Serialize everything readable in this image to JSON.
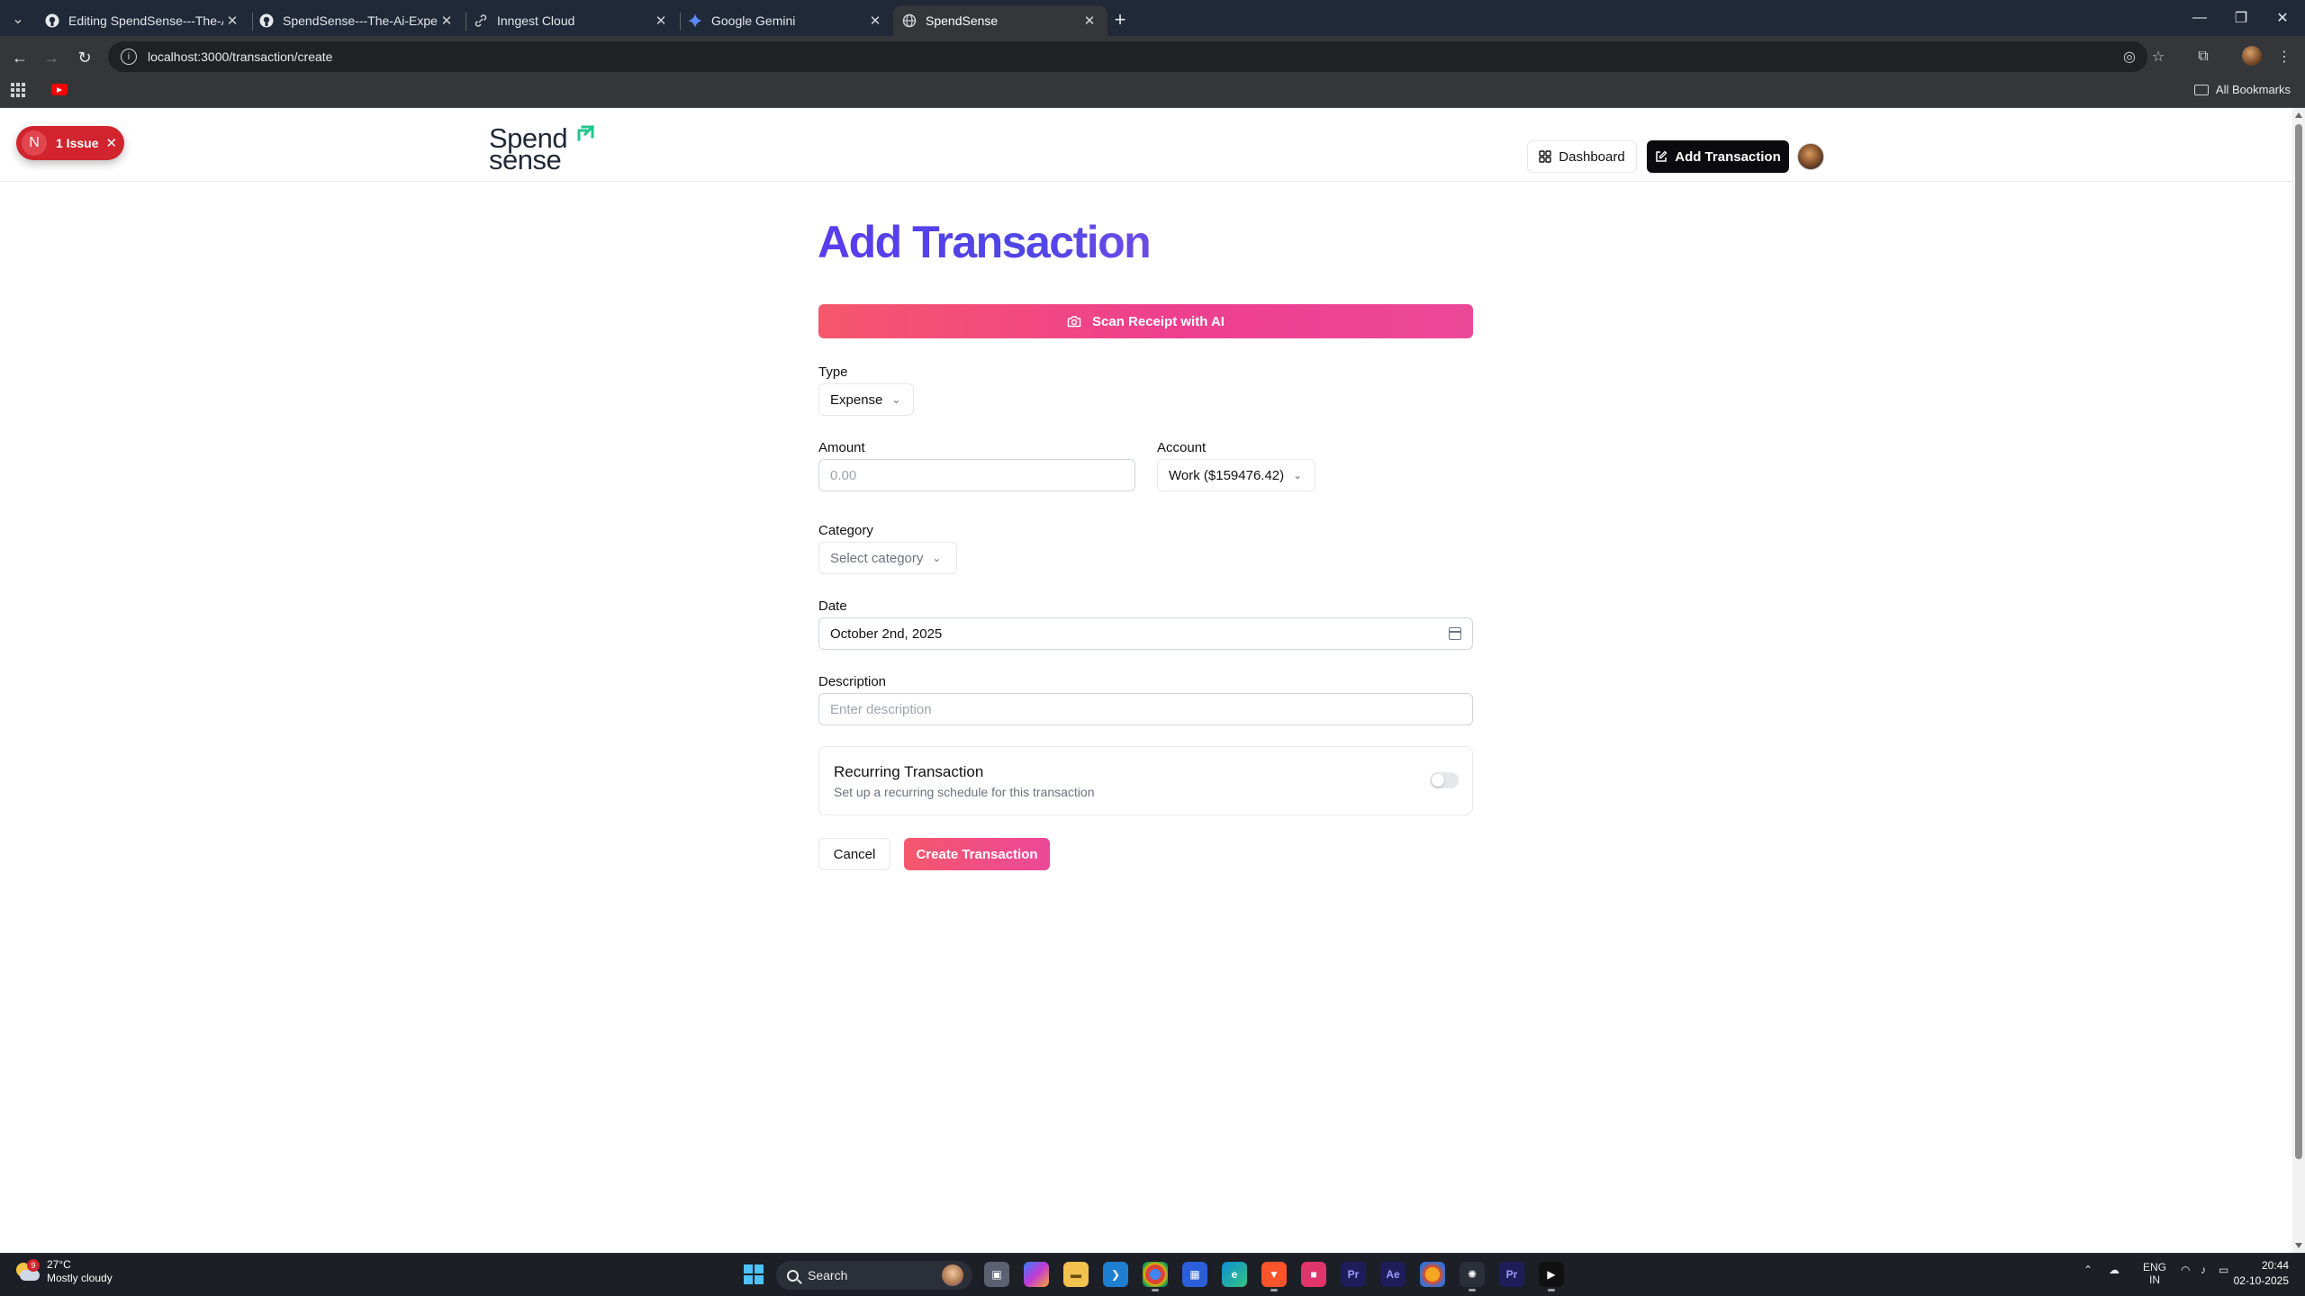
{
  "browser": {
    "tabs": [
      {
        "title": "Editing SpendSense---The-Ai-E",
        "icon": "github-icon",
        "active": false
      },
      {
        "title": "SpendSense---The-Ai-Expense",
        "icon": "github-icon",
        "active": false
      },
      {
        "title": "Inngest Cloud",
        "icon": "link-icon",
        "active": false
      },
      {
        "title": "Google Gemini",
        "icon": "gemini-icon",
        "active": false
      },
      {
        "title": "SpendSense",
        "icon": "globe-icon",
        "active": true
      }
    ],
    "url": "localhost:3000/transaction/create",
    "bookmarks_all_label": "All Bookmarks"
  },
  "devtools": {
    "badge_logo": "N",
    "issue_label": "1 Issue"
  },
  "site": {
    "logo_line1": "Spend",
    "logo_line2": "sense",
    "nav": {
      "dashboard_label": "Dashboard",
      "add_transaction_label": "Add Transaction"
    }
  },
  "form": {
    "title": "Add Transaction",
    "scan_button_label": "Scan Receipt with AI",
    "type": {
      "label": "Type",
      "value": "Expense"
    },
    "amount": {
      "label": "Amount",
      "placeholder": "0.00"
    },
    "account": {
      "label": "Account",
      "value": "Work ($159476.42)"
    },
    "category": {
      "label": "Category",
      "placeholder": "Select category"
    },
    "date": {
      "label": "Date",
      "value": "October 2nd, 2025"
    },
    "description": {
      "label": "Description",
      "placeholder": "Enter description"
    },
    "recurring": {
      "title": "Recurring Transaction",
      "subtitle": "Set up a recurring schedule for this transaction",
      "enabled": false
    },
    "cancel_label": "Cancel",
    "submit_label": "Create Transaction"
  },
  "taskbar": {
    "weather_temp": "27°C",
    "weather_desc": "Mostly cloudy",
    "weather_badge": "9",
    "search_label": "Search",
    "lang_line1": "ENG",
    "lang_line2": "IN",
    "time": "20:44",
    "date": "02-10-2025"
  },
  "colors": {
    "title_gradient": "#4f46e5",
    "accent_pink": "#ec4899",
    "accent_coral": "#f5576c",
    "primary_dark": "#0b0b0f",
    "issue_red": "#d1242f"
  }
}
